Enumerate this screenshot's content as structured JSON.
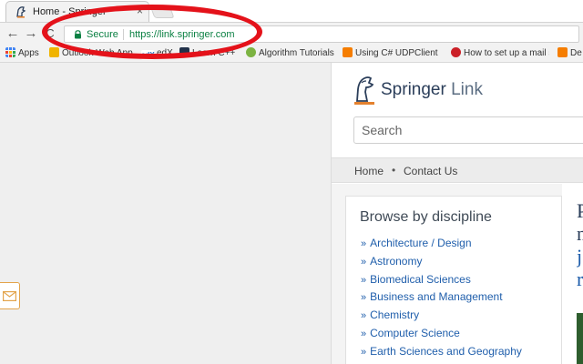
{
  "browser": {
    "tab": {
      "title": "Home - Springer",
      "close_glyph": "×"
    },
    "nav": {
      "back_glyph": "←",
      "forward_glyph": "→",
      "reload_glyph": "C"
    },
    "address": {
      "secure_label": "Secure",
      "url": "https://link.springer.com"
    },
    "bookmarks": [
      {
        "label": "Apps",
        "icon": "apps-grid-icon",
        "color": "#4285f4"
      },
      {
        "label": "Outlook Web App",
        "icon": "folder-icon",
        "color": "#f0b400"
      },
      {
        "label": "edX",
        "icon": "edx-icon",
        "color": "#1f6ec2"
      },
      {
        "label": "Learn C++",
        "icon": "cpp-icon",
        "color": "#22324a"
      },
      {
        "label": "Algorithm Tutorials",
        "icon": "bookmark-icon",
        "color": "#7cb342"
      },
      {
        "label": "Using C# UDPClient S",
        "icon": "blogger-icon",
        "color": "#f57d00"
      },
      {
        "label": "How to set up a mail s",
        "icon": "pinterest-icon",
        "color": "#cb2027"
      },
      {
        "label": "De",
        "icon": "blogger-icon",
        "color": "#f57d00"
      }
    ],
    "annotation_color": "#e4121a"
  },
  "site": {
    "logo": {
      "brand": "Springer",
      "suffix": "Link"
    },
    "search": {
      "placeholder": "Search"
    },
    "subnav": {
      "home": "Home",
      "contact": "Contact Us",
      "separator": "•"
    },
    "browse": {
      "title": "Browse by discipline",
      "bullet": "»",
      "items": [
        "Architecture / Design",
        "Astronomy",
        "Biomedical Sciences",
        "Business and Management",
        "Chemistry",
        "Computer Science",
        "Earth Sciences and Geography"
      ]
    },
    "teaser_fragments": [
      "P",
      "n",
      "j",
      "r"
    ],
    "accent": "#e4812e",
    "link_color": "#1f5eab"
  }
}
